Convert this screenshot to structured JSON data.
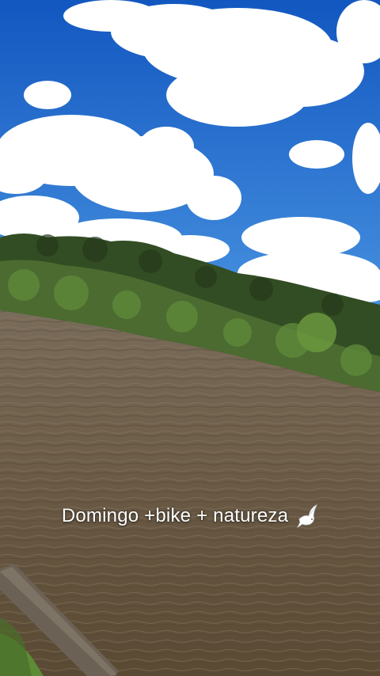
{
  "video": {
    "caption_text": "Domingo +bike + natureza",
    "caption_emoji": "dove-icon"
  },
  "colors": {
    "sky_top": "#1565c8",
    "sky_bottom": "#3f8fe0",
    "cloud": "#ffffff",
    "forest_dark": "#2f4a22",
    "forest_light": "#5c7a3a",
    "water": "#6b5d4a",
    "water_dark": "#564a3a",
    "grass": "#5a8a3a",
    "rail": "#6d6458"
  }
}
